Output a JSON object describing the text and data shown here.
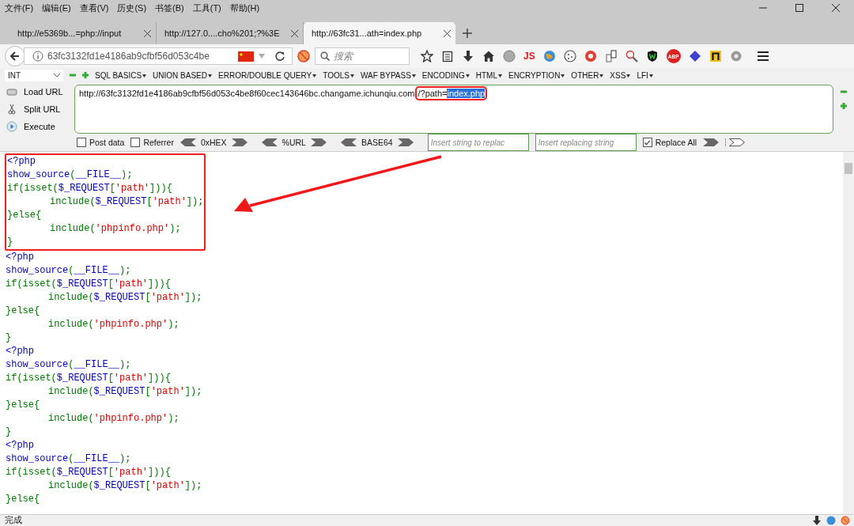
{
  "menu_bar": [
    "文件(F)",
    "编辑(E)",
    "查看(V)",
    "历史(S)",
    "书签(B)",
    "工具(T)",
    "帮助(H)"
  ],
  "tabs": [
    {
      "title": "http://e5369b...=php://input",
      "selected": false
    },
    {
      "title": "http://127.0....cho%201;?%3E",
      "selected": false
    },
    {
      "title": "http://63fc31...ath=index.php",
      "selected": true
    }
  ],
  "address_bar": {
    "url": "63fc3132fd1e4186ab9cfbf56d053c4be",
    "search_placeholder": "搜索"
  },
  "toolbar": {
    "js_label": "JS",
    "abp_label": "ABP"
  },
  "hackbar": {
    "type_select": "INT",
    "menus": [
      "SQL BASICS",
      "UNION BASED",
      "ERROR/DOUBLE QUERY",
      "TOOLS",
      "WAF BYPASS",
      "ENCODING",
      "HTML",
      "ENCRYPTION",
      "OTHER",
      "XSS",
      "LFI"
    ],
    "buttons": [
      "Load URL",
      "Split URL",
      "Execute"
    ],
    "url_text": "http://63fc3132fd1e4186ab9cfbf56d053c4be8f60cec143646bc.changame.ichunqiu.com",
    "url_boxed": "/?path=",
    "url_selected": "index.php",
    "options": [
      {
        "label": "Post data",
        "checked": false
      },
      {
        "label": "Referrer",
        "checked": false
      }
    ],
    "encoders": [
      "0xHEX",
      "%URL",
      "BASE64"
    ],
    "replace_placeholder": "Insert string to replac",
    "replacing_placeholder": "Insert replacing string",
    "replace_all": {
      "label": "Replace All",
      "checked": true
    }
  },
  "code_blocks": [
    {
      "highlighted": true,
      "lines": [
        {
          "indent": false,
          "tokens": [
            {
              "kind": "default",
              "text": "<?php"
            }
          ]
        },
        {
          "indent": false,
          "tokens": [
            {
              "kind": "default",
              "text": "show_source"
            },
            {
              "kind": "keyword",
              "text": "("
            },
            {
              "kind": "default",
              "text": "__FILE__"
            },
            {
              "kind": "keyword",
              "text": ");"
            }
          ]
        },
        {
          "indent": false,
          "tokens": [
            {
              "kind": "keyword",
              "text": "if(isset("
            },
            {
              "kind": "default",
              "text": "$_REQUEST"
            },
            {
              "kind": "keyword",
              "text": "["
            },
            {
              "kind": "string",
              "text": "'path'"
            },
            {
              "kind": "keyword",
              "text": "])){"
            }
          ]
        },
        {
          "indent": true,
          "tokens": [
            {
              "kind": "keyword",
              "text": "include("
            },
            {
              "kind": "default",
              "text": "$_REQUEST"
            },
            {
              "kind": "keyword",
              "text": "["
            },
            {
              "kind": "string",
              "text": "'path'"
            },
            {
              "kind": "keyword",
              "text": "]);"
            }
          ]
        },
        {
          "indent": false,
          "tokens": [
            {
              "kind": "keyword",
              "text": "}else{"
            }
          ]
        },
        {
          "indent": true,
          "tokens": [
            {
              "kind": "keyword",
              "text": "include("
            },
            {
              "kind": "string",
              "text": "'phpinfo.php'"
            },
            {
              "kind": "keyword",
              "text": ");"
            }
          ]
        },
        {
          "indent": false,
          "tokens": [
            {
              "kind": "keyword",
              "text": "}"
            }
          ]
        }
      ]
    },
    {
      "highlighted": false,
      "lines": [
        {
          "indent": false,
          "tokens": [
            {
              "kind": "default",
              "text": "<?php"
            }
          ]
        },
        {
          "indent": false,
          "tokens": [
            {
              "kind": "default",
              "text": "show_source"
            },
            {
              "kind": "keyword",
              "text": "("
            },
            {
              "kind": "default",
              "text": "__FILE__"
            },
            {
              "kind": "keyword",
              "text": ");"
            }
          ]
        },
        {
          "indent": false,
          "tokens": [
            {
              "kind": "keyword",
              "text": "if(isset("
            },
            {
              "kind": "default",
              "text": "$_REQUEST"
            },
            {
              "kind": "keyword",
              "text": "["
            },
            {
              "kind": "string",
              "text": "'path'"
            },
            {
              "kind": "keyword",
              "text": "])){"
            }
          ]
        },
        {
          "indent": true,
          "tokens": [
            {
              "kind": "keyword",
              "text": "include("
            },
            {
              "kind": "default",
              "text": "$_REQUEST"
            },
            {
              "kind": "keyword",
              "text": "["
            },
            {
              "kind": "string",
              "text": "'path'"
            },
            {
              "kind": "keyword",
              "text": "]);"
            }
          ]
        },
        {
          "indent": false,
          "tokens": [
            {
              "kind": "keyword",
              "text": "}else{"
            }
          ]
        },
        {
          "indent": true,
          "tokens": [
            {
              "kind": "keyword",
              "text": "include("
            },
            {
              "kind": "string",
              "text": "'phpinfo.php'"
            },
            {
              "kind": "keyword",
              "text": ");"
            }
          ]
        },
        {
          "indent": false,
          "tokens": [
            {
              "kind": "keyword",
              "text": "}"
            }
          ]
        }
      ]
    },
    {
      "highlighted": false,
      "lines": [
        {
          "indent": false,
          "tokens": [
            {
              "kind": "default",
              "text": "<?php"
            }
          ]
        },
        {
          "indent": false,
          "tokens": [
            {
              "kind": "default",
              "text": "show_source"
            },
            {
              "kind": "keyword",
              "text": "("
            },
            {
              "kind": "default",
              "text": "__FILE__"
            },
            {
              "kind": "keyword",
              "text": ");"
            }
          ]
        },
        {
          "indent": false,
          "tokens": [
            {
              "kind": "keyword",
              "text": "if(isset("
            },
            {
              "kind": "default",
              "text": "$_REQUEST"
            },
            {
              "kind": "keyword",
              "text": "["
            },
            {
              "kind": "string",
              "text": "'path'"
            },
            {
              "kind": "keyword",
              "text": "])){"
            }
          ]
        },
        {
          "indent": true,
          "tokens": [
            {
              "kind": "keyword",
              "text": "include("
            },
            {
              "kind": "default",
              "text": "$_REQUEST"
            },
            {
              "kind": "keyword",
              "text": "["
            },
            {
              "kind": "string",
              "text": "'path'"
            },
            {
              "kind": "keyword",
              "text": "]);"
            }
          ]
        },
        {
          "indent": false,
          "tokens": [
            {
              "kind": "keyword",
              "text": "}else{"
            }
          ]
        },
        {
          "indent": true,
          "tokens": [
            {
              "kind": "keyword",
              "text": "include("
            },
            {
              "kind": "string",
              "text": "'phpinfo.php'"
            },
            {
              "kind": "keyword",
              "text": ");"
            }
          ]
        },
        {
          "indent": false,
          "tokens": [
            {
              "kind": "keyword",
              "text": "}"
            }
          ]
        }
      ]
    },
    {
      "highlighted": false,
      "lines": [
        {
          "indent": false,
          "tokens": [
            {
              "kind": "default",
              "text": "<?php"
            }
          ]
        },
        {
          "indent": false,
          "tokens": [
            {
              "kind": "default",
              "text": "show_source"
            },
            {
              "kind": "keyword",
              "text": "("
            },
            {
              "kind": "default",
              "text": "__FILE__"
            },
            {
              "kind": "keyword",
              "text": ");"
            }
          ]
        },
        {
          "indent": false,
          "tokens": [
            {
              "kind": "keyword",
              "text": "if(isset("
            },
            {
              "kind": "default",
              "text": "$_REQUEST"
            },
            {
              "kind": "keyword",
              "text": "["
            },
            {
              "kind": "string",
              "text": "'path'"
            },
            {
              "kind": "keyword",
              "text": "])){"
            }
          ]
        },
        {
          "indent": true,
          "tokens": [
            {
              "kind": "keyword",
              "text": "include("
            },
            {
              "kind": "default",
              "text": "$_REQUEST"
            },
            {
              "kind": "keyword",
              "text": "["
            },
            {
              "kind": "string",
              "text": "'path'"
            },
            {
              "kind": "keyword",
              "text": "]);"
            }
          ]
        },
        {
          "indent": false,
          "tokens": [
            {
              "kind": "keyword",
              "text": "}else{"
            }
          ]
        }
      ]
    }
  ],
  "status_bar": {
    "text": "完成"
  }
}
